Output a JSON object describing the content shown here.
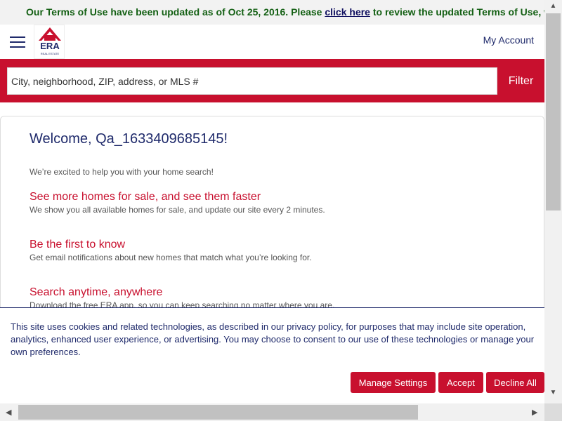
{
  "banner": {
    "prefix": "Our Terms of Use have been updated as of Oct 25, 2016. Please ",
    "link": "click here",
    "suffix": " to review the updated Terms of Use, which ar"
  },
  "header": {
    "logo_text": "ERA",
    "logo_sub": "REAL ESTATE",
    "my_account": "My Account"
  },
  "search": {
    "placeholder": "City, neighborhood, ZIP, address, or MLS #",
    "filter_label": "Filter"
  },
  "welcome": {
    "title": "Welcome, Qa_1633409685145!",
    "intro": "We’re excited to help you with your home search!",
    "features": [
      {
        "title": "See more homes for sale, and see them faster",
        "desc": "We show you all available homes for sale, and update our site every 2 minutes."
      },
      {
        "title": "Be the first to know",
        "desc": "Get email notifications about new homes that match what you’re looking for."
      },
      {
        "title": "Search anytime, anywhere",
        "desc": "Download the free ERA app, so you can keep searching no matter where you are."
      }
    ]
  },
  "cookie": {
    "text": "This site uses cookies and related technologies, as described in our privacy policy, for purposes that may include site operation, analytics, enhanced user experience, or advertising. You may choose to consent to our use of these technologies or manage your own preferences.",
    "manage_label": "Manage Settings",
    "accept_label": "Accept",
    "decline_label": "Decline All"
  },
  "colors": {
    "brand_red": "#c8102e",
    "navy": "#1f2a6b",
    "banner_green": "#146014"
  }
}
